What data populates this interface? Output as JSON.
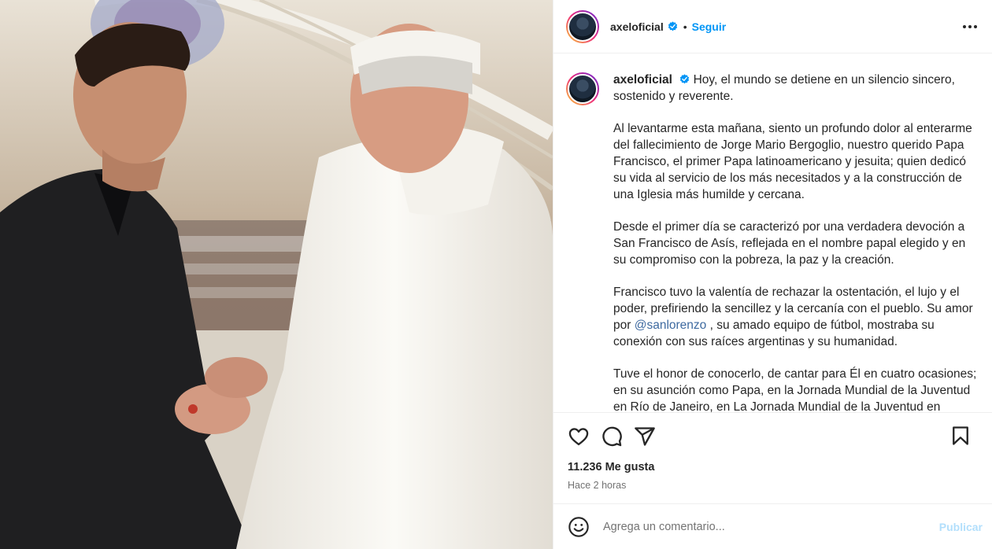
{
  "post": {
    "username": "axeloficial",
    "separator": "•",
    "follow_label": "Seguir",
    "caption_paragraphs": [
      "Hoy, el mundo se detiene en un silencio sincero, sostenido y reverente.",
      "Al levantarme esta mañana, siento un profundo dolor al enterarme del fallecimiento de Jorge Mario Bergoglio, nuestro querido Papa Francisco, el primer Papa latinoamericano y jesuita; quien dedicó su vida al servicio de los más necesitados y a la construcción de una Iglesia más humilde y cercana.",
      "Desde el primer día se caracterizó por una verdadera devoción a San Francisco de Asís, reflejada en el nombre papal elegido y en su compromiso con la pobreza, la paz y la creación.",
      "Francisco tuvo la valentía de rechazar la ostentación, el lujo y el poder, prefiriendo la sencillez y la cercanía con el pueblo. Su amor por",
      "@sanlorenzo",
      ", su amado equipo de fútbol, mostraba su conexión con sus raíces argentinas y su humanidad.",
      "Tuve el honor de conocerlo, de cantar para Él en cuatro ocasiones; en su asunción como Papa, en la Jornada Mundial de la Juventud en Río de Janeiro, en La Jornada Mundial de la Juventud en Panamá"
    ],
    "likes": "11.236 Me gusta",
    "time_ago": "Hace 2 horas",
    "comment_placeholder": "Agrega un comentario...",
    "publish_label": "Publicar"
  },
  "colors": {
    "accent": "#0095f6",
    "publish_disabled": "#b2dffc",
    "muted": "#737373"
  },
  "icons": [
    "verified-icon",
    "more-options-icon",
    "heart-icon",
    "comment-icon",
    "share-icon",
    "bookmark-icon",
    "emoji-icon"
  ]
}
